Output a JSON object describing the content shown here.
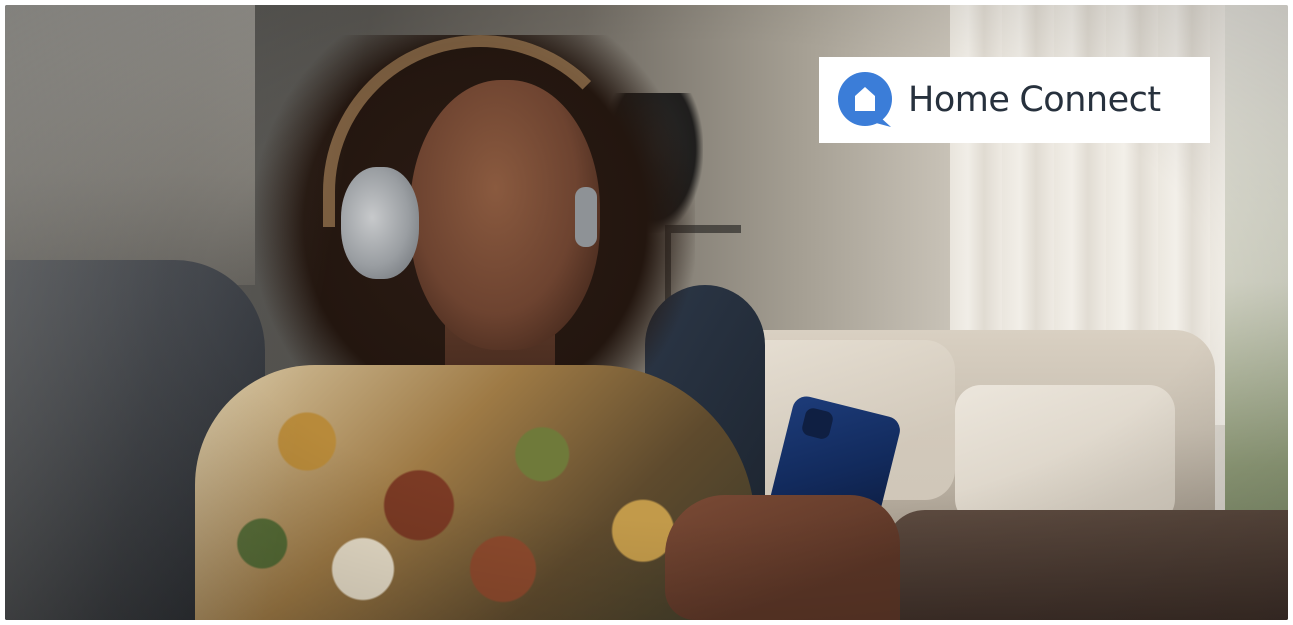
{
  "logo": {
    "word1": "Home",
    "word2": "Connect",
    "icon": "house-speech-bubble-icon",
    "brand_color": "#3b7dd8",
    "text_color": "#27313d"
  },
  "photo": {
    "icons": [
      "headphones-icon",
      "smartphone-icon"
    ]
  }
}
